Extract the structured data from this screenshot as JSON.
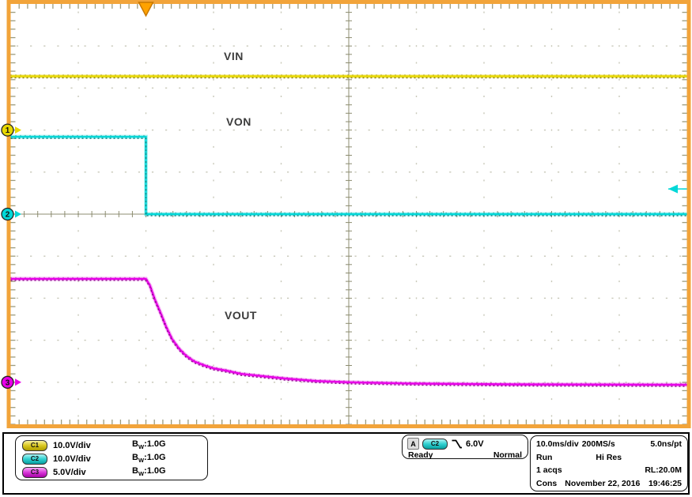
{
  "colors": {
    "frame": "#f2a43a",
    "trigger_marker_fill": "#ffa200",
    "trigger_marker_stroke": "#c87800",
    "grid_dot": "#c8c8b8",
    "tick": "#9c9c7e",
    "center_line": "#8c8c70",
    "c1": "#e8d800",
    "c1_dark": "#7a7000",
    "c2": "#00d8d8",
    "c2_dark": "#007a7a",
    "c3": "#e800e8",
    "c3_dark": "#850085",
    "label_text": "#3c3c3c"
  },
  "chart_data": {
    "type": "line",
    "title": "Oscilloscope capture of VIN, VON and VOUT during turn-off",
    "x_axis": {
      "divisions": 10,
      "time_per_div": "10.0ms"
    },
    "y_axis": {
      "divisions": 10
    },
    "grid": "dotted graticule with center crosshair",
    "legend_position": "on-trace labels",
    "trigger": {
      "source": "C2",
      "slope": "falling",
      "level_V": 6.0,
      "position_div": 2.0
    },
    "series": [
      {
        "name": "VIN",
        "channel": "C1",
        "volts_per_div": 10.0,
        "ref_div_from_center": -2,
        "color_key": "c1",
        "points_t_div_V": [
          [
            0,
            12.8
          ],
          [
            10,
            12.8
          ]
        ]
      },
      {
        "name": "VON",
        "channel": "C2",
        "volts_per_div": 10.0,
        "ref_div_from_center": 0,
        "color_key": "c2",
        "points_t_div_V": [
          [
            0,
            18.4
          ],
          [
            2.0,
            18.4
          ],
          [
            2.0,
            0
          ],
          [
            10,
            0
          ]
        ]
      },
      {
        "name": "VOUT",
        "channel": "C3",
        "volts_per_div": 5.0,
        "ref_div_from_center": 4,
        "color_key": "c3",
        "points_t_div_V": [
          [
            0,
            12.3
          ],
          [
            2.0,
            12.3
          ],
          [
            2.06,
            11.5
          ],
          [
            2.13,
            9.9
          ],
          [
            2.22,
            8.2
          ],
          [
            2.3,
            6.6
          ],
          [
            2.39,
            5.1
          ],
          [
            2.49,
            4.0
          ],
          [
            2.59,
            3.2
          ],
          [
            2.71,
            2.5
          ],
          [
            2.85,
            2.05
          ],
          [
            3.0,
            1.65
          ],
          [
            3.18,
            1.4
          ],
          [
            3.41,
            1.0
          ],
          [
            3.7,
            0.75
          ],
          [
            4.05,
            0.45
          ],
          [
            4.52,
            0.15
          ],
          [
            5.0,
            0.0
          ],
          [
            5.92,
            -0.15
          ],
          [
            7.44,
            -0.25
          ],
          [
            10,
            -0.3
          ]
        ]
      }
    ],
    "markers": [
      {
        "digit": "1",
        "channel": "C1",
        "color_key": "c1",
        "ref_div_from_center": -2
      },
      {
        "digit": "2",
        "channel": "C2",
        "color_key": "c2",
        "ref_div_from_center": 0
      },
      {
        "digit": "3",
        "channel": "C3",
        "color_key": "c3",
        "ref_div_from_center": 4
      }
    ],
    "wave_labels": [
      {
        "text": "VIN"
      },
      {
        "text": "VON"
      },
      {
        "text": "VOUT"
      }
    ]
  },
  "readout": {
    "bw_b": "B",
    "bw_w": "W",
    "channels": [
      {
        "badge": "C1",
        "scale": "10.0V/div",
        "bw_value": ":1.0G"
      },
      {
        "badge": "C2",
        "scale": "10.0V/div",
        "bw_value": ":1.0G"
      },
      {
        "badge": "C3",
        "scale": "5.0V/div",
        "bw_value": ":1.0G"
      }
    ],
    "trigger": {
      "a_badge": "A",
      "source_badge": "C2",
      "level": "6.0V",
      "state": "Ready",
      "mode": "Normal"
    },
    "timebase": {
      "scale": "10.0ms/div",
      "sample_rate": "200MS/s",
      "resolution": "5.0ns/pt",
      "state": "Run",
      "acq_mode": "Hi Res",
      "acqs": "1 acqs",
      "record_length": "RL:20.0M",
      "label": "Cons",
      "date": "November 22, 2016",
      "time": "19:46:25"
    }
  }
}
